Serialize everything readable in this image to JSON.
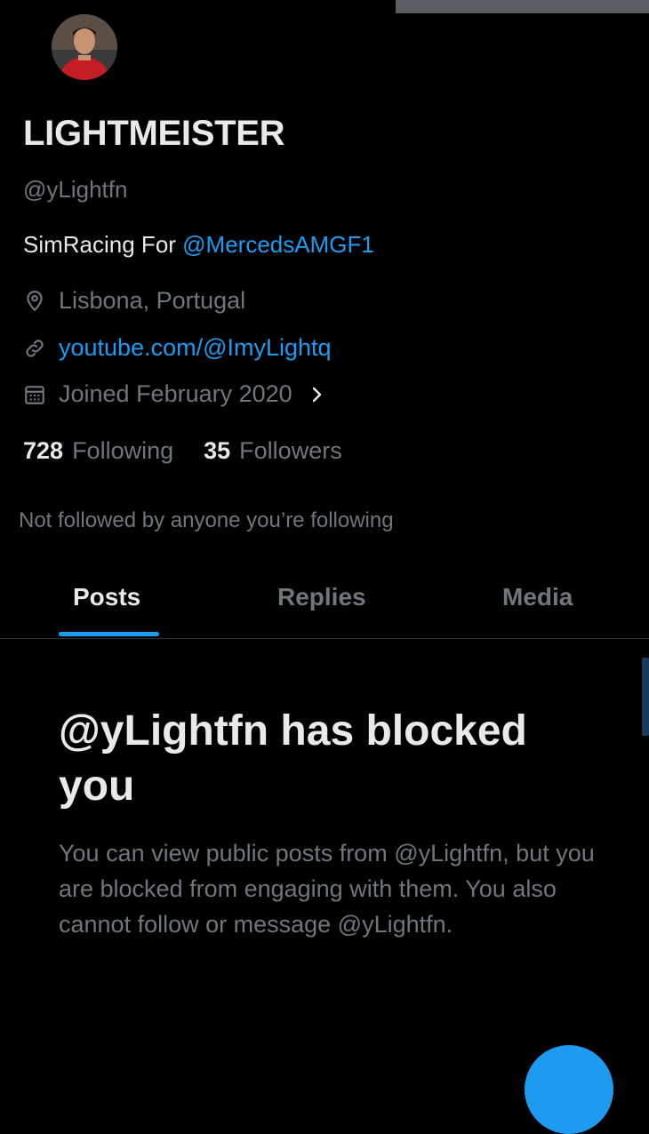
{
  "profile": {
    "display_name": "LIGHTMEISTER",
    "handle": "@yLightfn",
    "bio_text": "SimRacing For ",
    "bio_mention": "@MercedsAMGF1",
    "location": "Lisbona, Portugal",
    "website": "youtube.com/@ImyLightq",
    "joined": "Joined February 2020"
  },
  "stats": {
    "following_count": "728",
    "following_label": "Following",
    "followers_count": "35",
    "followers_label": "Followers"
  },
  "followed_note": "Not followed by anyone you’re following",
  "tabs": {
    "posts": "Posts",
    "replies": "Replies",
    "media": "Media",
    "active": "posts"
  },
  "blocked": {
    "title": "@yLightfn has blocked you",
    "description": "You can view public posts from @yLightfn, but you are blocked from engaging with them. You also cannot follow or message @yLightfn."
  },
  "icons": {
    "location": "location-pin-icon",
    "website": "link-icon",
    "joined": "calendar-icon",
    "chevron": "chevron-right-icon"
  },
  "colors": {
    "background": "#000000",
    "primary_text": "#e7e9ea",
    "secondary_text": "#71767b",
    "accent": "#1d9bf0"
  }
}
